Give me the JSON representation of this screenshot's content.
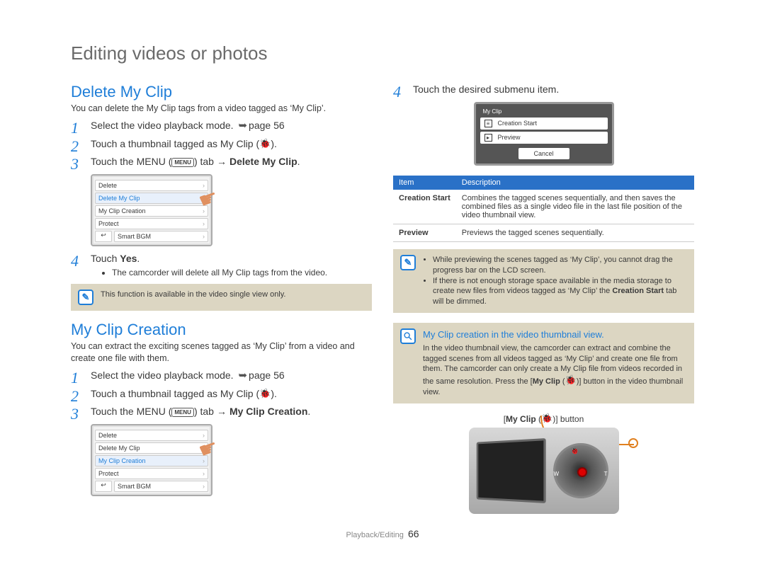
{
  "page_title": "Editing videos or photos",
  "footer_section": "Playback/Editing",
  "page_number": "66",
  "menu_chip": "MENU",
  "bug_glyph": "🐞",
  "left": {
    "section1": {
      "title": "Delete My Clip",
      "intro": "You can delete the My Clip tags from a video tagged as ‘My Clip’.",
      "step1_a": "Select the video playback mode.",
      "step1_ref": "page 56",
      "step2_a": "Touch a thumbnail tagged as My Clip (",
      "step2_b": ").",
      "step3_a": "Touch the MENU (",
      "step3_b": ") tab",
      "step3_target": "Delete My Clip",
      "step4": "Touch",
      "step4_yes": "Yes",
      "step4_bullet": "The camcorder will delete all My Clip tags from the video.",
      "note": "This function is available in the video single view only.",
      "lcd": {
        "r1": "Delete",
        "r2": "Delete My Clip",
        "r3": "My Clip Creation",
        "r4": "Protect",
        "r5": "Smart BGM",
        "back": "↩"
      }
    },
    "section2": {
      "title": "My Clip Creation",
      "intro": "You can extract the exciting scenes tagged as ‘My Clip’ from a video and create one file with them.",
      "step1_a": "Select the video playback mode.",
      "step1_ref": "page 56",
      "step2_a": "Touch a thumbnail tagged as My Clip (",
      "step2_b": ").",
      "step3_a": "Touch the MENU (",
      "step3_b": ") tab",
      "step3_target": "My Clip Creation",
      "lcd": {
        "r1": "Delete",
        "r2": "Delete My Clip",
        "r3": "My Clip Creation",
        "r4": "Protect",
        "r5": "Smart BGM",
        "back": "↩"
      }
    }
  },
  "right": {
    "step4": "Touch the desired submenu item.",
    "dialog": {
      "title": "My Clip",
      "opt1": "Creation Start",
      "opt2": "Preview",
      "cancel": "Cancel"
    },
    "table": {
      "h1": "Item",
      "h2": "Description",
      "r1_item": "Creation Start",
      "r1_desc": "Combines the tagged scenes sequentially, and then saves the combined files as a single video file in the last file position of the video thumbnail view.",
      "r2_item": "Preview",
      "r2_desc": "Previews the tagged scenes sequentially."
    },
    "note1": {
      "b1": "While previewing the scenes tagged as ‘My Clip’, you cannot drag the progress bar on the LCD screen.",
      "b2a": "If there is not enough storage space available in the media storage to create new files from videos tagged as ‘My Clip’ the ",
      "b2b": "Creation Start",
      "b2c": " tab will be dimmed."
    },
    "note2": {
      "title": "My Clip creation in the video thumbnail view.",
      "body_a": "In the video thumbnail view, the camcorder can extract and combine the tagged scenes from all videos tagged as ‘My Clip’ and create one file from them. The camcorder can only create a My Clip file from videos recorded in the same resolution. Press the [",
      "body_b": "My Clip",
      "body_c": " (",
      "body_d": ")] button in the video thumbnail view."
    },
    "callout_a": "[",
    "callout_b": "My Clip",
    "callout_c": " (",
    "callout_d": ")] button"
  }
}
